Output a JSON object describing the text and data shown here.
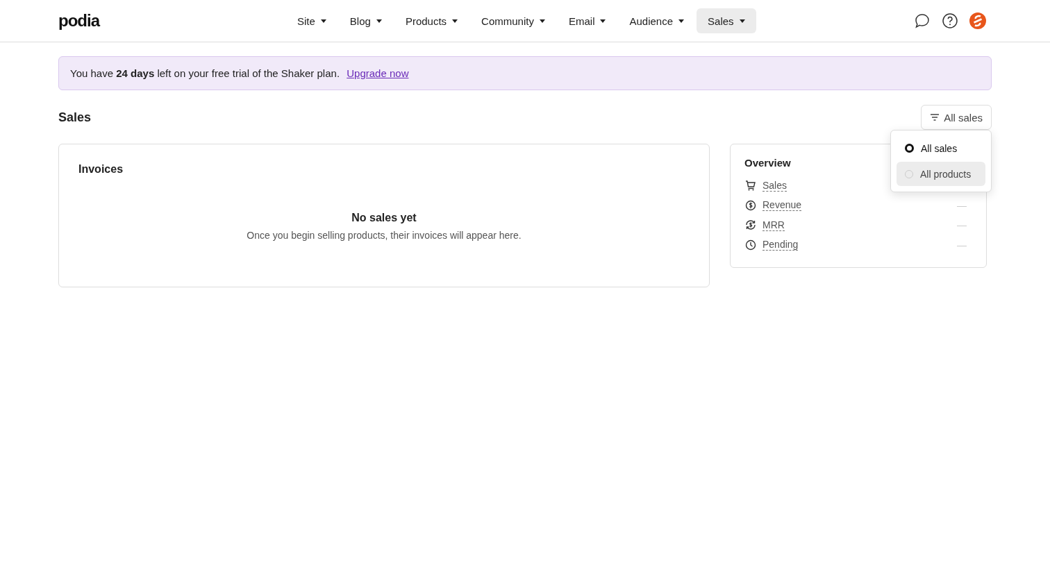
{
  "header": {
    "logo": "podia",
    "nav": [
      {
        "label": "Site",
        "selected": false
      },
      {
        "label": "Blog",
        "selected": false
      },
      {
        "label": "Products",
        "selected": false
      },
      {
        "label": "Community",
        "selected": false
      },
      {
        "label": "Email",
        "selected": false
      },
      {
        "label": "Audience",
        "selected": false
      },
      {
        "label": "Sales",
        "selected": true
      }
    ]
  },
  "banner": {
    "text": "You have **24 days** left on your free trial of the Shaker plan.",
    "link": "Upgrade now"
  },
  "page_title": "Sales",
  "filter": {
    "label": "All sales",
    "menu_open": true,
    "options": [
      {
        "label": "All sales",
        "selected": true,
        "hovered": false
      },
      {
        "label": "All products",
        "selected": false,
        "hovered": true
      }
    ]
  },
  "invoices": {
    "title": "Invoices",
    "empty_title": "No sales yet",
    "empty_text": "Once you begin selling products, their invoices will appear here."
  },
  "overview": {
    "title": "Overview",
    "items": [
      {
        "kind": "cart",
        "label": "Sales"
      },
      {
        "kind": "dollar",
        "label": "Revenue",
        "value": "—"
      },
      {
        "kind": "recurring",
        "label": "MRR",
        "value": "—"
      },
      {
        "kind": "clock",
        "label": "Pending",
        "value": "—"
      }
    ]
  }
}
